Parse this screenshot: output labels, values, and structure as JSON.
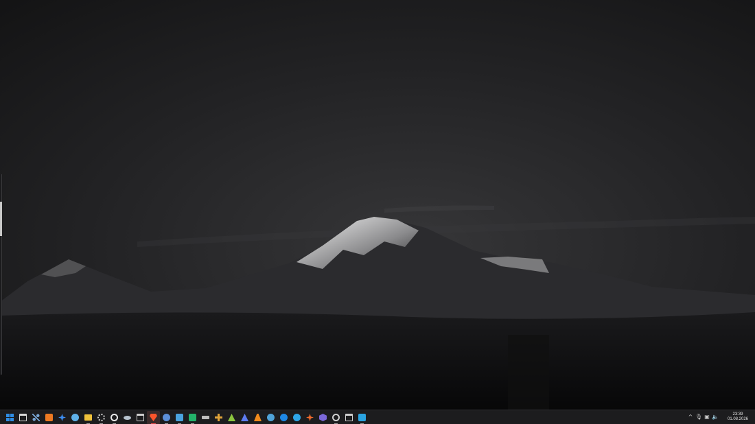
{
  "taskbar": {
    "icons": [
      {
        "name": "start-menu-icon",
        "color": "#2f8de4",
        "shape": "grid",
        "running": false
      },
      {
        "name": "task-view-icon",
        "color": "#d9d9d9",
        "shape": "window",
        "running": false
      },
      {
        "name": "network-tool-icon",
        "color": "#7aa6d6",
        "shape": "nodes",
        "running": false
      },
      {
        "name": "orange-app-icon",
        "color": "#ee7a22",
        "shape": "square",
        "running": false
      },
      {
        "name": "spark-app-icon",
        "color": "#3d8ff5",
        "shape": "star",
        "running": false
      },
      {
        "name": "steam-icon",
        "color": "#5fb0e8",
        "shape": "circle",
        "running": false
      },
      {
        "name": "file-explorer-icon",
        "color": "#f0c23b",
        "shape": "folder",
        "running": true
      },
      {
        "name": "settings-gear-icon",
        "color": "#d6d6d6",
        "shape": "gear",
        "running": true
      },
      {
        "name": "obs-icon",
        "color": "#e8e8e8",
        "shape": "ring",
        "running": true
      },
      {
        "name": "fish-app-icon",
        "color": "#b8c4d0",
        "shape": "oval",
        "running": false
      },
      {
        "name": "terminal-window-icon",
        "color": "#cfcfcf",
        "shape": "window",
        "running": false
      },
      {
        "name": "brave-browser-icon",
        "color": "#fb542b",
        "shape": "shield",
        "running": true
      },
      {
        "name": "chromium-browser-icon",
        "color": "#5b8fd8",
        "shape": "circle",
        "running": true
      },
      {
        "name": "mail-app-icon",
        "color": "#4aa3df",
        "shape": "square",
        "running": true
      },
      {
        "name": "green-app-icon",
        "color": "#23b26a",
        "shape": "square",
        "running": true
      },
      {
        "name": "keyboard-app-icon",
        "color": "#bdbdbd",
        "shape": "bar",
        "running": false
      },
      {
        "name": "game-tool-icon",
        "color": "#e0a43a",
        "shape": "cross",
        "running": false
      },
      {
        "name": "recycle-app-icon",
        "color": "#8cc63f",
        "shape": "triangle",
        "running": false
      },
      {
        "name": "delta-app-icon",
        "color": "#5d7cf0",
        "shape": "triangle",
        "running": false
      },
      {
        "name": "vlc-media-player-icon",
        "color": "#f08a1c",
        "shape": "cone",
        "running": false
      },
      {
        "name": "eye-app-icon",
        "color": "#4fa3d8",
        "shape": "circle",
        "running": false
      },
      {
        "name": "blue-app-icon",
        "color": "#1e88e5",
        "shape": "circle",
        "running": false
      },
      {
        "name": "feather-app-icon",
        "color": "#2ea6e8",
        "shape": "circle",
        "running": false
      },
      {
        "name": "asterisk-app-icon",
        "color": "#f06a2b",
        "shape": "star",
        "running": false
      },
      {
        "name": "virtual-box-icon",
        "color": "#7b68d9",
        "shape": "cube",
        "running": false
      },
      {
        "name": "clock-app-icon",
        "color": "#cfcfcf",
        "shape": "ring",
        "running": true
      },
      {
        "name": "console-app-icon",
        "color": "#cfcfcf",
        "shape": "window",
        "running": false
      },
      {
        "name": "store-app-icon",
        "color": "#2aa3e0",
        "shape": "square",
        "running": true
      }
    ],
    "active_index": 11,
    "tray": [
      {
        "name": "show-hidden-icons-chevron-icon",
        "glyph": "^"
      },
      {
        "name": "microphone-icon",
        "glyph": "🎙"
      },
      {
        "name": "network-icon",
        "glyph": "▣"
      },
      {
        "name": "volume-icon",
        "glyph": "🔈"
      }
    ],
    "clock": {
      "time": "23:39",
      "date": "01.08.2026"
    }
  }
}
